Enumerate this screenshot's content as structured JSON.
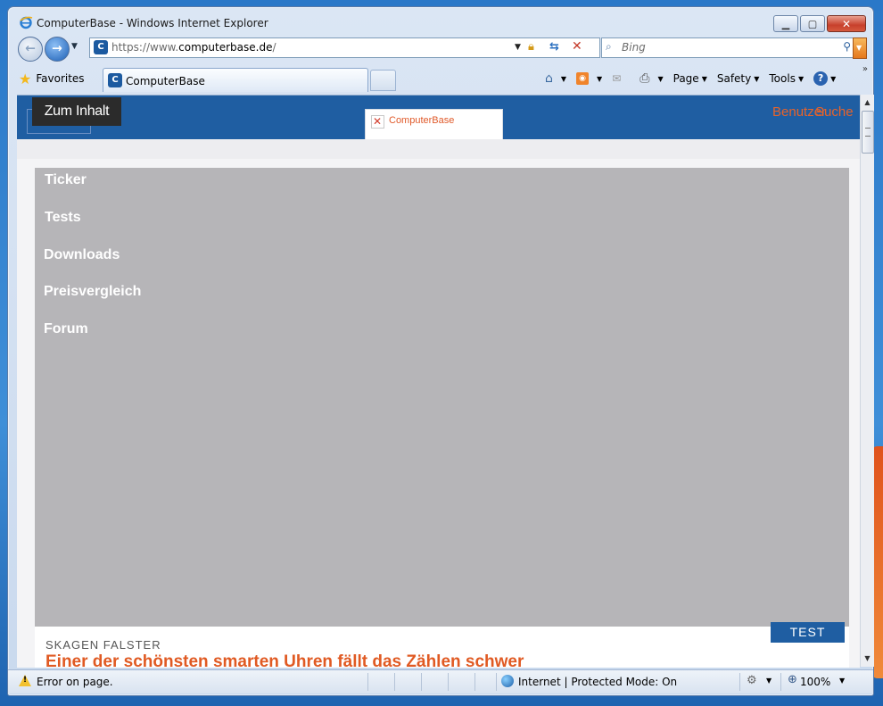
{
  "window": {
    "title": "ComputerBase - Windows Internet Explorer",
    "buttons": {
      "minimize": "▭",
      "maximize": "◻",
      "close": "✕"
    }
  },
  "address_bar": {
    "url_prefix": "https://www.",
    "url_domain": "computerbase.de",
    "url_suffix": "/"
  },
  "search_box": {
    "placeholder": "Bing"
  },
  "favorites": {
    "label": "Favorites"
  },
  "tab": {
    "title": "ComputerBase"
  },
  "command_bar": {
    "page": "Page",
    "safety": "Safety",
    "tools": "Tools"
  },
  "site": {
    "skip_link": "Zum Inhalt",
    "logo_alt": "ComputerBase",
    "user_links": [
      "Benutzer",
      "Suche"
    ],
    "nav": [
      "Ticker",
      "Tests",
      "Downloads",
      "Preisvergleich",
      "Forum"
    ],
    "article": {
      "badge": "TEST",
      "kicker": "SKAGEN FALSTER",
      "headline": "Einer der schönsten smarten Uhren fällt das Zählen schwer"
    }
  },
  "status_bar": {
    "message": "Error on page.",
    "zone": "Internet | Protected Mode: On",
    "zoom": "100%"
  },
  "colors": {
    "header_blue": "#1f5ea2",
    "accent_orange": "#e05a23",
    "panel_gray": "#b6b5b8"
  }
}
